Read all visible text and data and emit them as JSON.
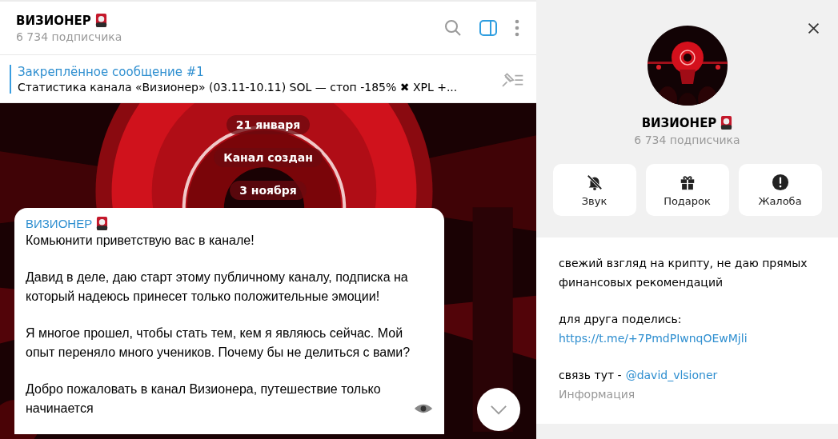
{
  "chat": {
    "title": "ВИЗИОНЕР",
    "subscribers": "6 734 подписчика",
    "side_panel_open": true
  },
  "pinned": {
    "title": "Закреплённое сообщение #1",
    "text": "Статистика канала «Визионер» (03.11-10.11)  SOL — стоп -185% ✖ XPL +..."
  },
  "service_messages": [
    "21 января",
    "Канал создан",
    "3 ноября"
  ],
  "message": {
    "author": "ВИЗИОНЕР",
    "paragraphs": [
      "Комьюнити приветствую вас в канале!",
      "Давид в деле, даю старт этому публичному каналу, подписка на который надеюсь принесет только положительные эмоции!",
      "Я многое прошел, чтобы стать тем, кем я являюсь сейчас. Мой опыт переняло много учеников. Почему бы не делиться с вами?",
      "Добро пожаловать в канал Визионера, путешествие только начинается"
    ]
  },
  "profile": {
    "name": "ВИЗИОНЕР",
    "subscribers": "6 734 подписчика",
    "actions": [
      {
        "label": "Звук",
        "kind": "mute"
      },
      {
        "label": "Подарок",
        "kind": "gift"
      },
      {
        "label": "Жалоба",
        "kind": "report"
      }
    ],
    "description": "свежий взгляд на крипту, не даю прямых финансовых рекомендаций",
    "share": {
      "text": "для друга поделись:",
      "link": "https://t.me/+7PmdPIwnqOEwMjli"
    },
    "contact": {
      "text": "связь тут -",
      "link": "@david_vlsioner"
    },
    "info_label": "Информация"
  }
}
